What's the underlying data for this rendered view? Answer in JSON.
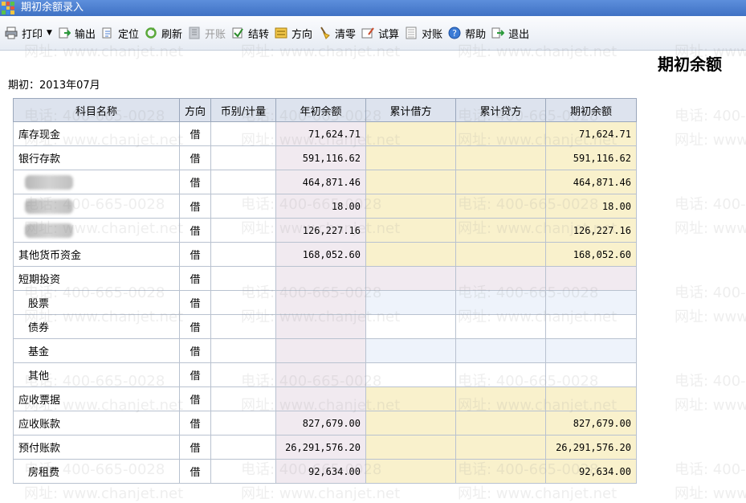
{
  "window": {
    "title": "期初余额录入"
  },
  "toolbar": {
    "buttons": [
      {
        "label": "打印",
        "icon": "printer-icon",
        "enabled": true
      },
      {
        "label": "输出",
        "icon": "export-icon",
        "enabled": true
      },
      {
        "label": "定位",
        "icon": "locate-icon",
        "enabled": true
      },
      {
        "label": "刷新",
        "icon": "refresh-icon",
        "enabled": true
      },
      {
        "label": "开账",
        "icon": "ledger-icon",
        "enabled": false
      },
      {
        "label": "结转",
        "icon": "carry-forward-icon",
        "enabled": true
      },
      {
        "label": "方向",
        "icon": "direction-icon",
        "enabled": true
      },
      {
        "label": "清零",
        "icon": "broom-icon",
        "enabled": true
      },
      {
        "label": "试算",
        "icon": "calculate-icon",
        "enabled": true
      },
      {
        "label": "对账",
        "icon": "reconcile-icon",
        "enabled": true
      },
      {
        "label": "帮助",
        "icon": "help-icon",
        "enabled": true
      },
      {
        "label": "退出",
        "icon": "exit-icon",
        "enabled": true
      }
    ]
  },
  "page": {
    "title": "期初余额",
    "period": "期初：2013年07月"
  },
  "table": {
    "headers": [
      "科目名称",
      "方向",
      "币别/计量",
      "年初余额",
      "累计借方",
      "累计贷方",
      "期初余额"
    ],
    "rows": [
      {
        "name": "库存现金",
        "dir": "借",
        "unit": "",
        "year_open": "71,624.71",
        "debit": "",
        "credit": "",
        "opening": "71,624.71",
        "style": "yellow"
      },
      {
        "name": "银行存款",
        "dir": "借",
        "unit": "",
        "year_open": "591,116.62",
        "debit": "",
        "credit": "",
        "opening": "591,116.62",
        "style": "yellow"
      },
      {
        "name": "",
        "blurred": true,
        "dir": "借",
        "unit": "",
        "year_open": "464,871.46",
        "debit": "",
        "credit": "",
        "opening": "464,871.46",
        "style": "yellow"
      },
      {
        "name": "",
        "blurred": true,
        "dir": "借",
        "unit": "",
        "year_open": "18.00",
        "debit": "",
        "credit": "",
        "opening": "18.00",
        "style": "yellow"
      },
      {
        "name": "",
        "blurred": true,
        "dir": "借",
        "unit": "",
        "year_open": "126,227.16",
        "debit": "",
        "credit": "",
        "opening": "126,227.16",
        "style": "yellow"
      },
      {
        "name": "其他货币资金",
        "dir": "借",
        "unit": "",
        "year_open": "168,052.60",
        "debit": "",
        "credit": "",
        "opening": "168,052.60",
        "style": "yellow"
      },
      {
        "name": "短期投资",
        "dir": "借",
        "unit": "",
        "year_open": "",
        "debit": "",
        "credit": "",
        "opening": "",
        "style": "pink"
      },
      {
        "name": "股票",
        "indent": true,
        "dir": "借",
        "unit": "",
        "year_open": "",
        "debit": "",
        "credit": "",
        "opening": "",
        "style": "blue"
      },
      {
        "name": "债券",
        "indent": true,
        "dir": "借",
        "unit": "",
        "year_open": "",
        "debit": "",
        "credit": "",
        "opening": "",
        "style": "white"
      },
      {
        "name": "基金",
        "indent": true,
        "dir": "借",
        "unit": "",
        "year_open": "",
        "debit": "",
        "credit": "",
        "opening": "",
        "style": "blue"
      },
      {
        "name": "其他",
        "indent": true,
        "dir": "借",
        "unit": "",
        "year_open": "",
        "debit": "",
        "credit": "",
        "opening": "",
        "style": "white"
      },
      {
        "name": "应收票据",
        "dir": "借",
        "unit": "",
        "year_open": "",
        "debit": "",
        "credit": "",
        "opening": "",
        "style": "yellow"
      },
      {
        "name": "应收账款",
        "dir": "借",
        "unit": "",
        "year_open": "827,679.00",
        "debit": "",
        "credit": "",
        "opening": "827,679.00",
        "style": "yellow"
      },
      {
        "name": "预付账款",
        "dir": "借",
        "unit": "",
        "year_open": "26,291,576.20",
        "debit": "",
        "credit": "",
        "opening": "26,291,576.20",
        "style": "yellow"
      },
      {
        "name": "房租费",
        "indent": true,
        "dir": "借",
        "unit": "",
        "year_open": "92,634.00",
        "debit": "",
        "credit": "",
        "opening": "92,634.00",
        "style": "yellow"
      }
    ]
  },
  "watermark": {
    "phone": "电话: 400-665-0028",
    "site": "网址: www.chanjet.net"
  }
}
